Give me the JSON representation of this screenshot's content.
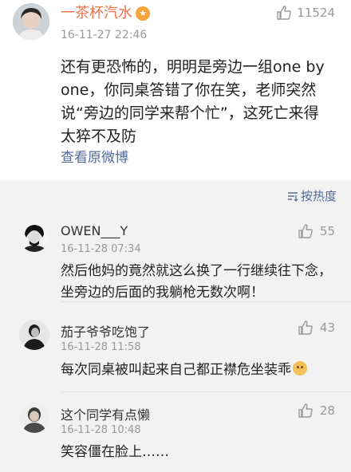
{
  "main_comment": {
    "username": "一茶杯汽水",
    "badge": "★",
    "timestamp": "16-11-27 22:46",
    "likes": "11524",
    "text": "还有更恐怖的，明明是旁边一组one by one，你同桌答错了你在笑，老师突然说“旁边的同学来帮个忙”，这死亡来得太猝不及防",
    "view_link": "查看原微博"
  },
  "sort": {
    "label": "按热度"
  },
  "comments": [
    {
      "username": "OWEN___Y",
      "timestamp": "16-11-28 07:34",
      "likes": "55",
      "line1": "然后他妈的竟然就这么换了一行继续往下念，",
      "line2": "坐旁边的后面的我躺枪无数次啊！"
    },
    {
      "username": "茄子爷爷吃饱了",
      "timestamp": "16-11-28 11:58",
      "likes": "43",
      "line1": "每次同桌被叫起来自己都正襟危坐装乖"
    },
    {
      "username": "这个同学有点懒",
      "timestamp": "16-11-28 10:48",
      "likes": "28",
      "line1": "笑容僵在脸上……"
    }
  ],
  "colors": {
    "username_accent": "#eb7350",
    "link": "#506b9b",
    "muted": "#999999"
  },
  "icons": {
    "like": "thumbs-up-icon",
    "sort": "sort-icon",
    "badge": "member-badge-icon",
    "emoji": "doge-emoji-icon"
  }
}
